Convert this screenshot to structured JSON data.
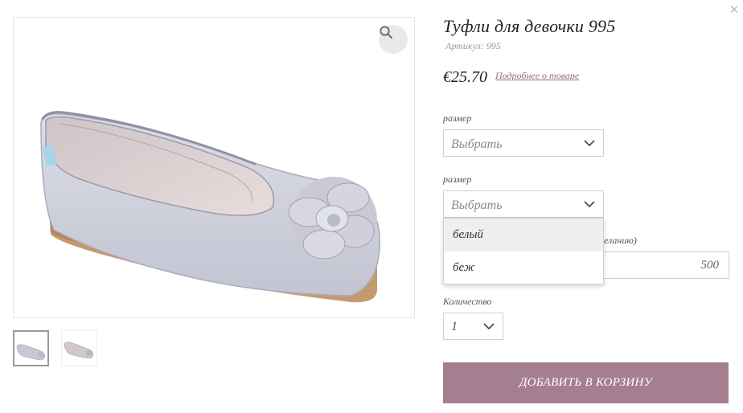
{
  "modal": {
    "close_symbol": "✕"
  },
  "gallery": {
    "main_image_alt": "Туфли для девочки 995",
    "zoom_icon": "search-icon",
    "thumbnails": [
      {
        "state": "active"
      },
      {
        "state": "inactive"
      }
    ]
  },
  "product": {
    "title": "Туфли для девочки 995",
    "sku_label": "Артикул:",
    "sku_value": "995",
    "price": "€25.70",
    "details_link": "Подробнее о товаре"
  },
  "options": {
    "size_label": "размер",
    "size_value": "Выбрать",
    "color_label": "размер",
    "color_value": "Выбрать",
    "color_dropdown": [
      "белый",
      "беж"
    ],
    "amount_label_visible": "желанию)",
    "amount_value": "500",
    "quantity_label": "Количество",
    "quantity_value": "1"
  },
  "cart": {
    "add_button": "ДОБАВИТЬ В КОРЗИНУ"
  },
  "colors": {
    "accent": "#a57f8f",
    "link": "#9b6a83",
    "border": "#cfcfcf",
    "dropdown_highlight": "#efefef"
  }
}
